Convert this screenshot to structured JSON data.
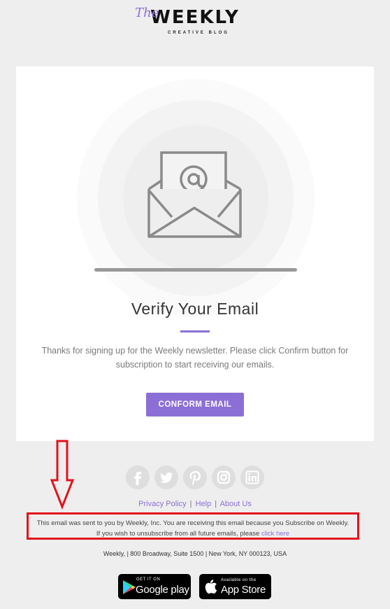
{
  "logo": {
    "the": "The",
    "main": "WEEKLY",
    "sub": "CREATIVE BLOG"
  },
  "card": {
    "title": "Verify Your Email",
    "description": "Thanks for signing up for the Weekly newsletter. Please click Confirm button for subscription to start receiving our emails.",
    "button_label": "CONFORM EMAIL",
    "accent_color": "#8c6fd6"
  },
  "social": [
    {
      "name": "facebook-icon"
    },
    {
      "name": "twitter-icon"
    },
    {
      "name": "pinterest-icon"
    },
    {
      "name": "instagram-icon"
    },
    {
      "name": "linkedin-icon"
    }
  ],
  "footer": {
    "links": {
      "privacy": "Privacy Policy",
      "help": "Help",
      "about": "About Us",
      "separator": "|"
    },
    "notice_line1": "This email was sent to you by Weekly, Inc. You are receiving this email because you Subscribe on Weekly.",
    "notice_line2_prefix": "If you wish to unsubscribe from all future emails, please ",
    "notice_link": "click here",
    "address": "Weekly, | 800 Broadway, Suite 1500 | New York, NY 000123, USA",
    "highlight_color": "#e2121c"
  },
  "badges": {
    "google": {
      "small": "GET IT ON",
      "big": "Google play"
    },
    "apple": {
      "small": "Available on the",
      "big": "App Store"
    }
  }
}
